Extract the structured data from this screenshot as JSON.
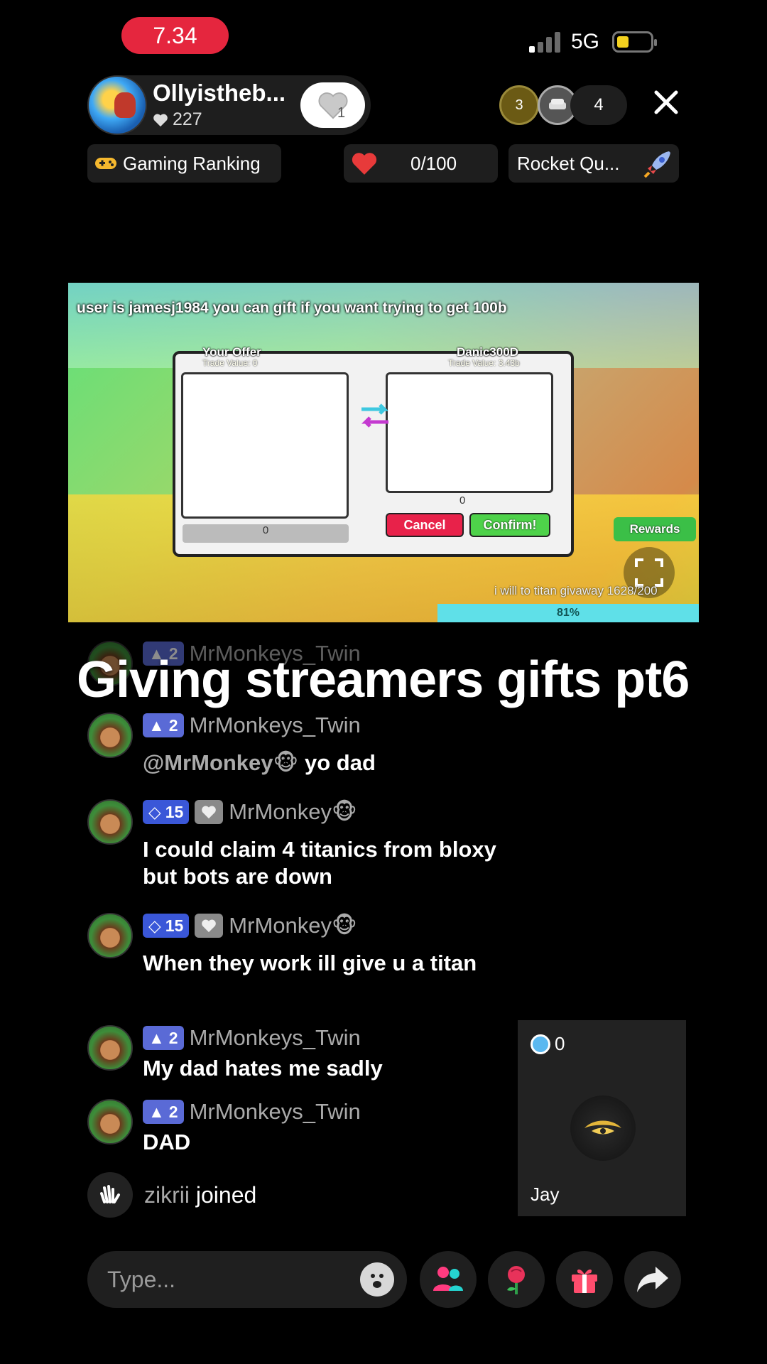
{
  "status_bar": {
    "time": "7.34",
    "network": "5G"
  },
  "host": {
    "name": "Ollyistheb...",
    "likes": "227",
    "follow_count": "1"
  },
  "viewers": {
    "badge1_rank": "3",
    "count": "4"
  },
  "chips": {
    "ranking_label": "Gaming Ranking",
    "goal_value": "0/100",
    "quest_label": "Rocket Qu..."
  },
  "video": {
    "banner": "user is jamesj1984 you can gift if you want trying to get 100b",
    "your_offer": "Your Offer",
    "your_trade_value": "Trade Value: 0",
    "other_player": "Danic300D",
    "other_trade_value": "Trade Value: 3.43b",
    "left_value": "0",
    "right_value": "0",
    "cancel": "Cancel",
    "confirm": "Confirm!",
    "rewards": "Rewards",
    "giveaway": "i will to titan givaway 1628/200",
    "progress": "81%"
  },
  "overlay_title": "Giving streamers gifts pt6",
  "chat": [
    {
      "level": "2",
      "name": "MrMonkeys_Twin",
      "mention": "@MrMonkey🐵",
      "text": " yo dad"
    },
    {
      "level": "15",
      "name": "MrMonkey🐵",
      "text": "I could claim 4 titanics from bloxy but bots are down"
    },
    {
      "level": "15",
      "name": "MrMonkey🐵",
      "text": "When they work ill give u a titan"
    },
    {
      "level": "2",
      "name": "MrMonkeys_Twin",
      "text": "My dad hates me sadly"
    },
    {
      "level": "2",
      "name": "MrMonkeys_Twin",
      "text": "DAD"
    }
  ],
  "partial_chat": {
    "level": "2",
    "name": "MrMonkeys_Twin"
  },
  "join": {
    "name": "zikrii",
    "text": " joined"
  },
  "gift_card": {
    "count": "0",
    "name": "Jay"
  },
  "bottom": {
    "placeholder": "Type..."
  },
  "colors": {
    "accent_red": "#e5263e",
    "level_blue": "#5a6ad6",
    "panel": "#1e1e1e"
  }
}
